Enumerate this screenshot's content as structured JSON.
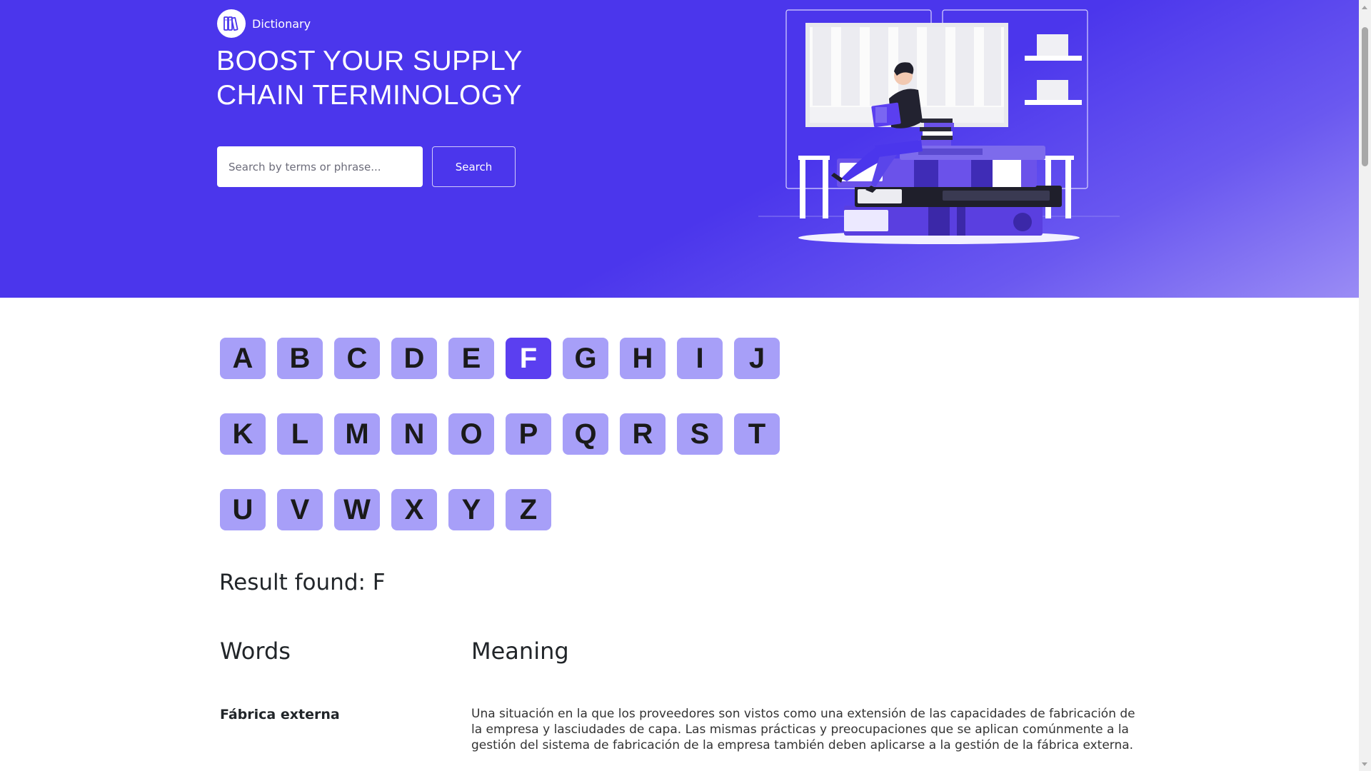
{
  "brand": {
    "name": "Dictionary",
    "icon": "books-icon"
  },
  "hero": {
    "title": "BOOST YOUR SUPPLY CHAIN TERMINOLOGY",
    "search_placeholder": "Search by terms or phrase...",
    "search_value": "",
    "search_button": "Search",
    "illustration": "person-reading-on-books-illustration"
  },
  "alphabet": {
    "rows": [
      [
        "A",
        "B",
        "C",
        "D",
        "E",
        "F",
        "G",
        "H",
        "I",
        "J"
      ],
      [
        "K",
        "L",
        "M",
        "N",
        "O",
        "P",
        "Q",
        "R",
        "S",
        "T"
      ],
      [
        "U",
        "V",
        "W",
        "X",
        "Y",
        "Z"
      ]
    ],
    "selected": "F"
  },
  "results": {
    "heading": "Result found: F",
    "columns": {
      "words": "Words",
      "meaning": "Meaning"
    },
    "entries": [
      {
        "word": "Fábrica externa",
        "meaning": "Una situación en la que los proveedores son vistos como una extensión de las capacidades de fabricación de la empresa y lasciudades de capa. Las mismas prácticas y preocupaciones que se aplican comúnmente a la gestión del sistema de fabricación de la empresa también deben aplicarse a la gestión de la fábrica externa."
      }
    ]
  },
  "colors": {
    "hero_bg": "#4b36ec",
    "letter_bg": "#a79ff8",
    "letter_active_bg": "#5b3ff0"
  }
}
